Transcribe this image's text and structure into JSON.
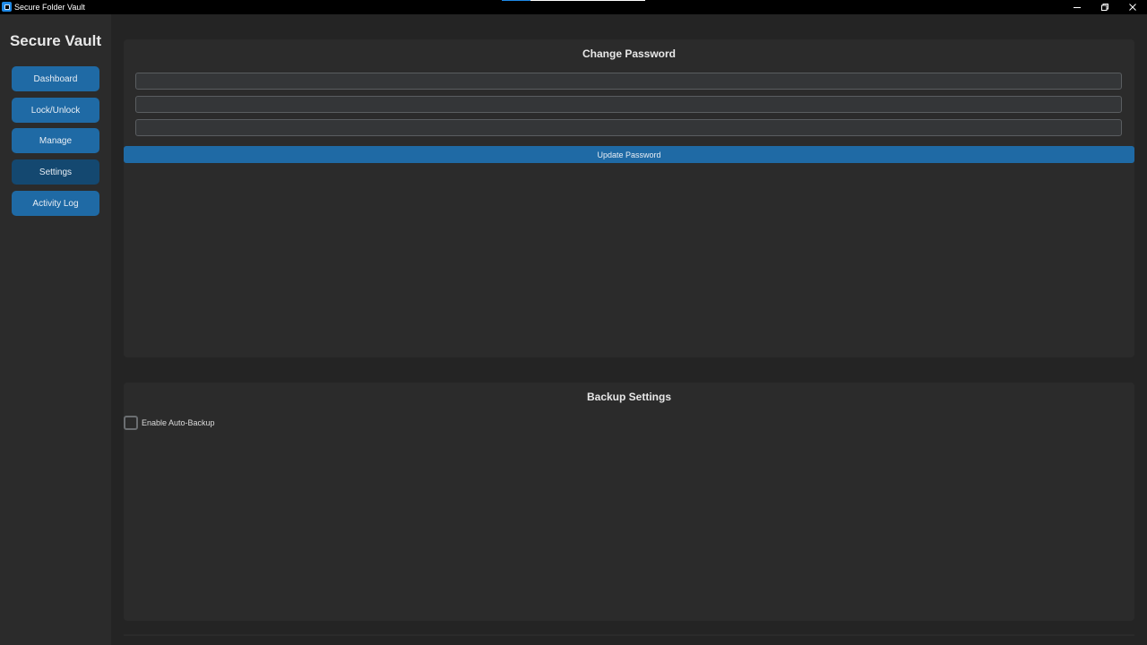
{
  "window": {
    "title": "Secure Folder Vault",
    "accent_color": "#1e88e5"
  },
  "sidebar": {
    "brand": "Secure Vault",
    "items": [
      {
        "label": "Dashboard",
        "active": false
      },
      {
        "label": "Lock/Unlock",
        "active": false
      },
      {
        "label": "Manage",
        "active": false
      },
      {
        "label": "Settings",
        "active": true
      },
      {
        "label": "Activity Log",
        "active": false
      }
    ],
    "button_color": "#1f6aa5",
    "active_button_color": "#144870"
  },
  "change_password": {
    "title": "Change Password",
    "fields": [
      {
        "value": "",
        "placeholder": ""
      },
      {
        "value": "",
        "placeholder": ""
      },
      {
        "value": "",
        "placeholder": ""
      }
    ],
    "update_button_label": "Update Password"
  },
  "backup_settings": {
    "title": "Backup Settings",
    "auto_backup_label": "Enable Auto-Backup",
    "auto_backup_checked": false
  }
}
